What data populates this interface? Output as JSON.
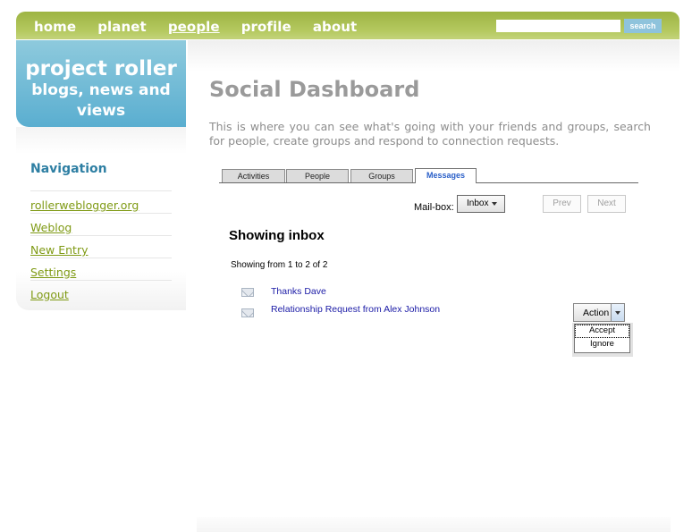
{
  "topnav": {
    "items": [
      {
        "label": "home",
        "active": false
      },
      {
        "label": "planet",
        "active": false
      },
      {
        "label": "people",
        "active": true
      },
      {
        "label": "profile",
        "active": false
      },
      {
        "label": "about",
        "active": false
      }
    ],
    "search_value": "",
    "search_button": "search"
  },
  "brand": {
    "title": "project roller",
    "subtitle_line1": "blogs, news and",
    "subtitle_line2": "views"
  },
  "sidebar": {
    "heading": "Navigation",
    "items": [
      {
        "label": "rollerweblogger.org"
      },
      {
        "label": "Weblog"
      },
      {
        "label": "New Entry"
      },
      {
        "label": "Settings"
      },
      {
        "label": "Logout"
      }
    ]
  },
  "main": {
    "title": "Social Dashboard",
    "intro": "This is where you can see what's going with your friends and groups, search for people, create groups and respond to connection requests.",
    "tabs": [
      {
        "label": "Activities",
        "active": false
      },
      {
        "label": "People",
        "active": false
      },
      {
        "label": "Groups",
        "active": false
      },
      {
        "label": "Messages",
        "active": true
      }
    ],
    "mailbox": {
      "label": "Mail-box:",
      "selected": "Inbox"
    },
    "pager": {
      "prev": "Prev",
      "next": "Next"
    },
    "inbox_heading": "Showing inbox",
    "showing_count": "Showing from 1 to 2 of 2",
    "messages": [
      {
        "subject": "Thanks Dave",
        "icon": "envelope-icon"
      },
      {
        "subject": "Relationship Request from Alex Johnson",
        "icon": "envelope-icon"
      }
    ],
    "action": {
      "label": "Action",
      "options": [
        "Accept",
        "Ignore"
      ],
      "focused_option": "Accept"
    }
  },
  "colors": {
    "topbar_green": "#a9bf50",
    "brand_blue": "#6bb8d6",
    "nav_heading": "#2e7fa3",
    "nav_link": "#7f9a14",
    "title_gray": "#9a9a9a",
    "active_tab_text": "#2a5fc8",
    "message_link": "#1a1aa6"
  }
}
